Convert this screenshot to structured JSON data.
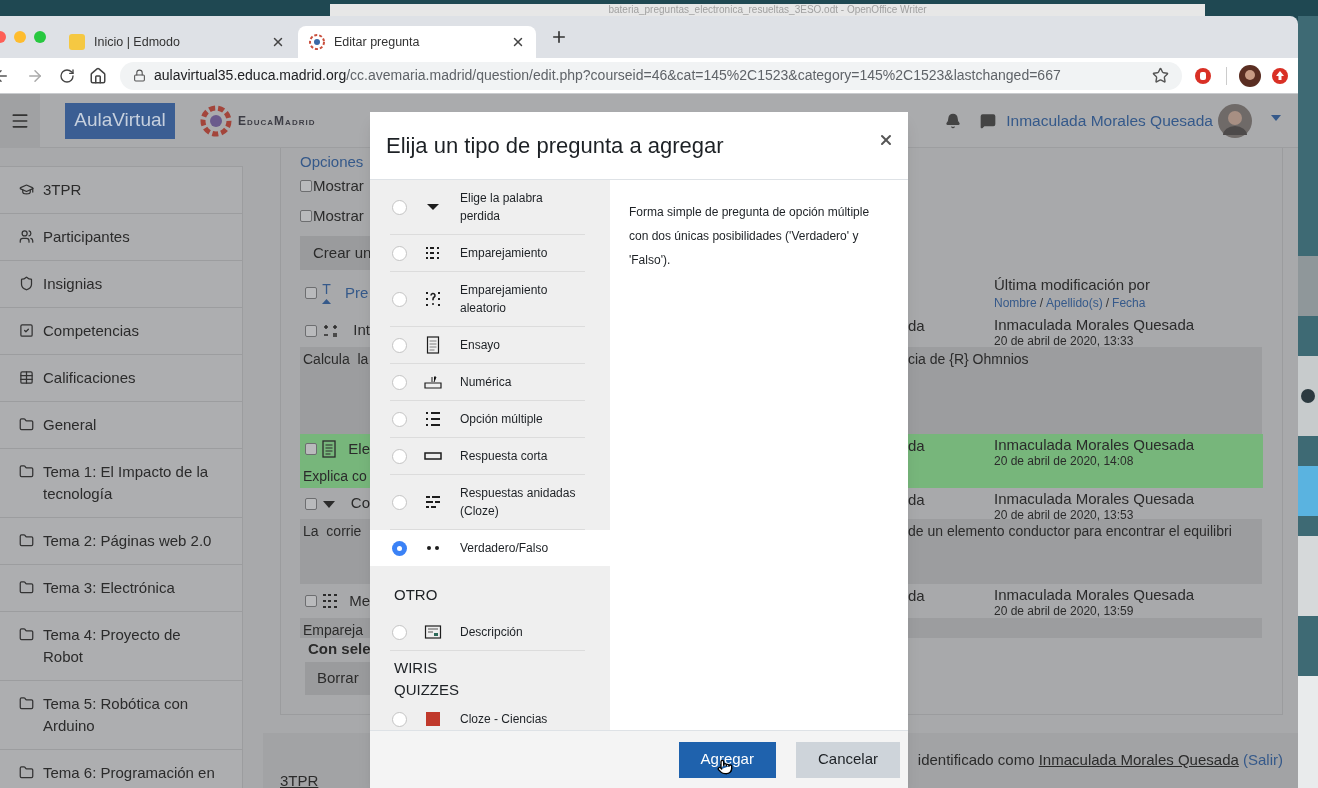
{
  "desktop": {
    "background_window_title": "bateria_preguntas_electronica_resueltas_3ESO.odt - OpenOffice Writer"
  },
  "browser": {
    "tabs": [
      {
        "title": "Inicio | Edmodo",
        "selected": false
      },
      {
        "title": "Editar pregunta",
        "selected": true
      }
    ],
    "url_host": "aulavirtual35.educa.madrid.org",
    "url_path": "/cc.avemaria.madrid/question/edit.php?courseid=46&cat=145%2C1523&category=145%2C1523&lastchanged=667"
  },
  "navbar": {
    "brand": "AulaVirtual",
    "logo_text": "EducaMadrid",
    "user_name": "Inmaculada Morales Quesada"
  },
  "sidebar": {
    "items": [
      {
        "label": "3TPR"
      },
      {
        "label": "Participantes"
      },
      {
        "label": "Insignias"
      },
      {
        "label": "Competencias"
      },
      {
        "label": "Calificaciones"
      },
      {
        "label": "General"
      },
      {
        "label": "Tema 1: El Impacto de la tecnología"
      },
      {
        "label": "Tema 2: Páginas web 2.0"
      },
      {
        "label": "Tema 3: Electrónica"
      },
      {
        "label": "Tema 4: Proyecto de Robot"
      },
      {
        "label": "Tema 5: Robótica con Arduino"
      },
      {
        "label": "Tema 6: Programación en"
      }
    ]
  },
  "question_bank": {
    "options_link": "Opciones",
    "show_options": [
      {
        "label": "Mostrar",
        "checked": false
      },
      {
        "label": "Mostrar",
        "checked": false
      }
    ],
    "create_button": "Crear un",
    "header": {
      "select_all_checked": false,
      "type_sort": "T",
      "question_sort": "Pre",
      "last_modified": "Última modificación por",
      "sort_links": [
        "Nombre",
        "Apellido(s)",
        "Fecha"
      ],
      "separator": "/"
    },
    "rows": [
      {
        "name": "Int",
        "checked": false,
        "highlighted": false,
        "creator": "da",
        "modified_by": "Inmaculada Morales Quesada",
        "date": "20 de abril de 2020, 13:33",
        "text_left": "Calcula  la",
        "text_right": "cia de {R} Ohmnios"
      },
      {
        "name": "Ele",
        "checked": false,
        "highlighted": true,
        "creator": "da",
        "modified_by": "Inmaculada Morales Quesada",
        "date": "20 de abril de 2020, 14:08",
        "text_left": "Explica co"
      },
      {
        "name": "Co",
        "checked": false,
        "highlighted": false,
        "creator": "da",
        "modified_by": "Inmaculada Morales Quesada",
        "date": "20 de abril de 2020, 13:53",
        "text_left": "La  corrie",
        "text_right": "de un elemento conductor para encontrar el equilibri"
      },
      {
        "name": "Me",
        "checked": false,
        "highlighted": false,
        "creator": "da",
        "modified_by": "Inmaculada Morales Quesada",
        "date": "20 de abril de 2020, 13:59",
        "text_left": "Empareja"
      }
    ],
    "with_selected": "Con sele",
    "delete_button": "Borrar"
  },
  "footer": {
    "login_text": "identificado como",
    "user_link": "Inmaculada Morales Quesada",
    "logout_link": "(Salir)",
    "course_link": "3TPR"
  },
  "modal": {
    "title": "Elija un tipo de pregunta a agregar",
    "items": [
      {
        "kind": "option",
        "label": "Elige la palabra perdida",
        "selected": false
      },
      {
        "kind": "option",
        "label": "Emparejamiento",
        "selected": false
      },
      {
        "kind": "option",
        "label": "Emparejamiento aleatorio",
        "selected": false
      },
      {
        "kind": "option",
        "label": "Ensayo",
        "selected": false
      },
      {
        "kind": "option",
        "label": "Numérica",
        "selected": false
      },
      {
        "kind": "option",
        "label": "Opción múltiple",
        "selected": false
      },
      {
        "kind": "option",
        "label": "Respuesta corta",
        "selected": false
      },
      {
        "kind": "option",
        "label": "Respuestas anidadas (Cloze)",
        "selected": false
      },
      {
        "kind": "option",
        "label": "Verdadero/Falso",
        "selected": true
      },
      {
        "kind": "heading",
        "label": "OTRO"
      },
      {
        "kind": "option",
        "label": "Descripción",
        "selected": false
      },
      {
        "kind": "heading",
        "label": "WIRIS QUIZZES"
      },
      {
        "kind": "option",
        "label": "Cloze - Ciencias",
        "selected": false
      }
    ],
    "description": "Forma simple de pregunta de opción múltiple con dos únicas posibilidades ('Verdadero' y 'Falso').",
    "buttons": [
      {
        "label": "Agregar",
        "kind": "primary"
      },
      {
        "label": "Cancelar",
        "kind": "secondary"
      }
    ]
  }
}
